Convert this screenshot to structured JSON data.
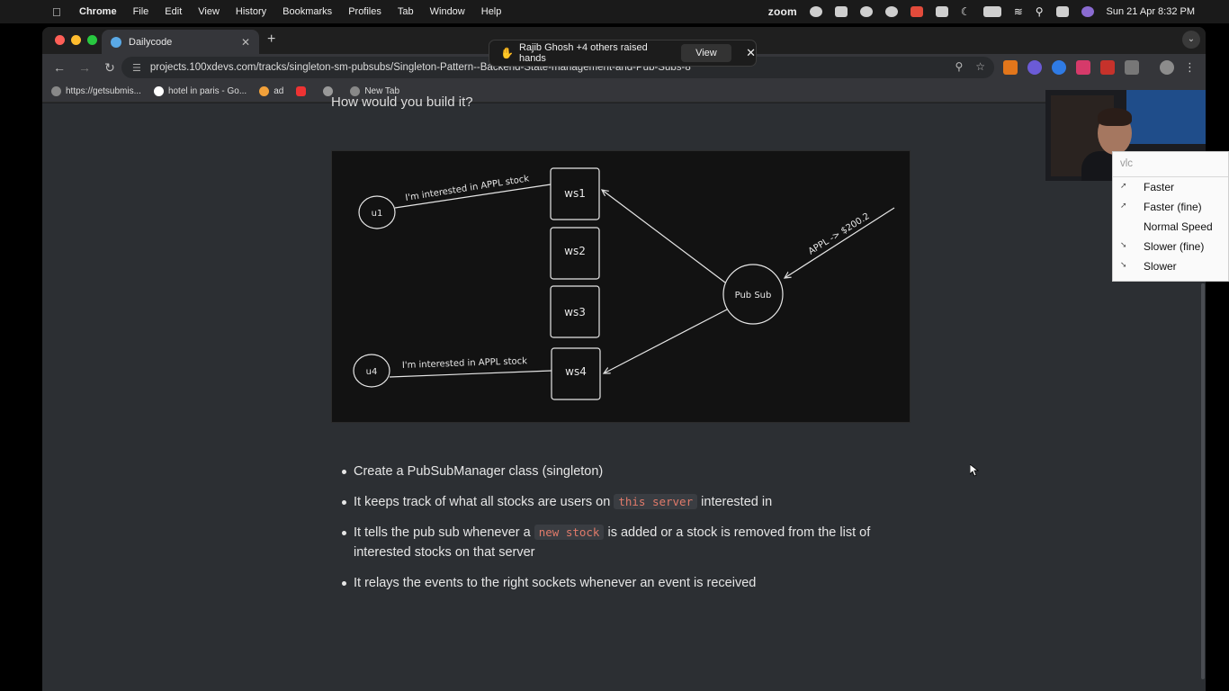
{
  "menubar": {
    "app": "Chrome",
    "items": [
      "File",
      "Edit",
      "View",
      "History",
      "Bookmarks",
      "Profiles",
      "Tab",
      "Window",
      "Help"
    ],
    "zoom_label": "zoom",
    "datetime": "Sun 21 Apr  8:32 PM"
  },
  "browser": {
    "tab_title": "Dailycode",
    "url": "projects.100xdevs.com/tracks/singleton-sm-pubsubs/Singleton-Pattern--Backend-State-management-and-Pub-Subs-8",
    "bookmarks": [
      "https://getsubmis...",
      "hotel in paris - Go...",
      "ad",
      "",
      "",
      "New Tab"
    ]
  },
  "zoom_notification": {
    "text": "Rajib Ghosh +4 others raised hands",
    "view_label": "View"
  },
  "page": {
    "cut_heading": "How would you build it?",
    "diagram": {
      "u1": "u1",
      "u4": "u4",
      "ws1": "ws1",
      "ws2": "ws2",
      "ws3": "ws3",
      "ws4": "ws4",
      "pubsub": "Pub Sub",
      "msg_top": "I'm interested in APPL stock",
      "msg_bottom": "I'm interested in APPL stock",
      "price": "APPL -> $200.2"
    },
    "bullets": {
      "b1": "Create a PubSubManager class (singleton)",
      "b2_pre": "It keeps track of what all stocks are users on ",
      "b2_code": "this server",
      "b2_post": " interested in",
      "b3_pre": "It tells the pub sub whenever a ",
      "b3_code": "new stock",
      "b3_post": " is added or a stock is removed from the list of interested stocks on that server",
      "b4": "It relays the events to the right sockets whenever an event is received"
    }
  },
  "vlc_menu": {
    "search_placeholder": "vlc",
    "items": [
      "Faster",
      "Faster (fine)",
      "Normal Speed",
      "Slower (fine)",
      "Slower"
    ]
  }
}
